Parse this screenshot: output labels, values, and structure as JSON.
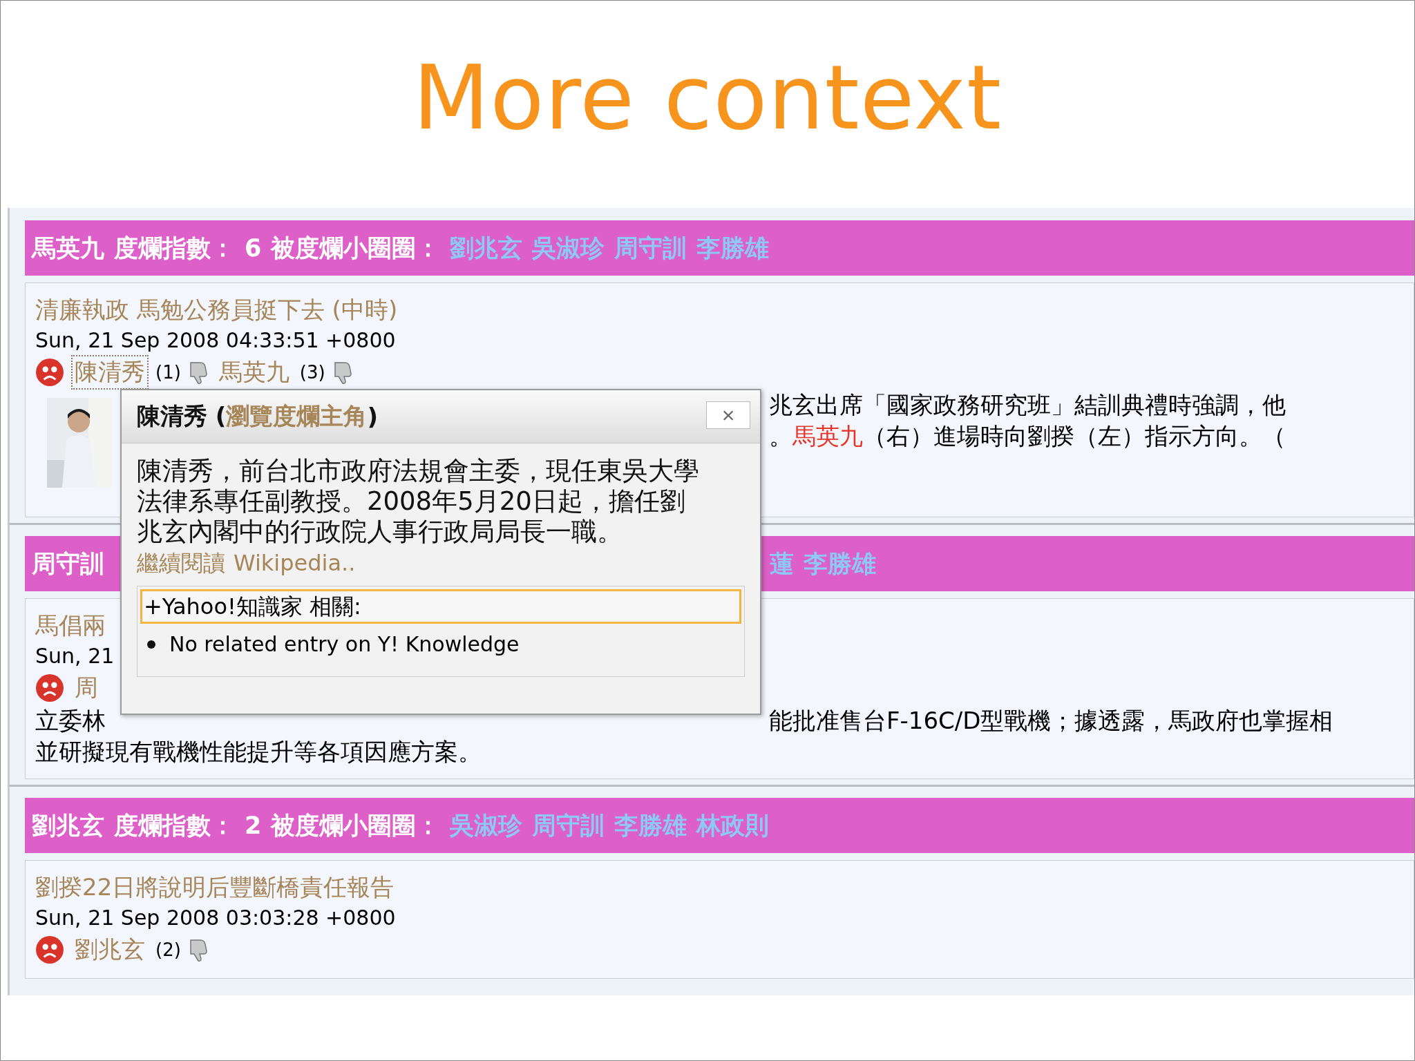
{
  "slide": {
    "title": "More context"
  },
  "sections": [
    {
      "header": {
        "name": "馬英九",
        "index_label": "度爛指數：",
        "index": "6",
        "circle_label": "被度爛小圈圈：",
        "circle": [
          "劉兆玄",
          "吳淑珍",
          "周守訓",
          "李勝雄"
        ]
      },
      "article": {
        "title": "清廉執政 馬勉公務員挺下去 (中時)",
        "date": "Sun, 21 Sep 2008 04:33:51 +0800",
        "people": [
          {
            "name": "陳清秀",
            "count": "(1)",
            "highlighted": true
          },
          {
            "name": "馬英九",
            "count": "(3)",
            "highlighted": false
          }
        ],
        "lines": [
          {
            "kind": "split",
            "right": [
              {
                "kind": "plain",
                "text": "兆玄出席「國家政務研究班」結訓典禮時強調，他"
              }
            ]
          },
          {
            "kind": "split",
            "right": [
              {
                "kind": "plain",
                "text": "。"
              },
              {
                "kind": "name",
                "text": "馬英九"
              },
              {
                "kind": "plain",
                "text": "（右）進場時向劉揆（左）指示方向。（"
              }
            ]
          }
        ]
      }
    },
    {
      "header": {
        "name": "周守訓",
        "kind": "split",
        "circle": [
          "蓮",
          "李勝雄"
        ]
      },
      "article": {
        "title": "馬倡兩",
        "date": "Sun, 21",
        "people": [
          {
            "name": "周",
            "highlighted": false
          }
        ],
        "lines": [
          {
            "kind": "split",
            "left": "立委林",
            "right": [
              {
                "kind": "plain",
                "text": "能批准售台F-16C/D型戰機；據透露，馬政府也掌握相"
              }
            ]
          },
          {
            "kind": "full",
            "right": [
              {
                "kind": "plain",
                "text": "並研擬現有戰機性能提升等各項因應方案。"
              }
            ]
          }
        ]
      }
    },
    {
      "header": {
        "name": "劉兆玄",
        "index_label": "度爛指數：",
        "index": "2",
        "circle_label": "被度爛小圈圈：",
        "circle": [
          "吳淑珍",
          "周守訓",
          "李勝雄",
          "林政則"
        ]
      },
      "article": {
        "title": "劉揆22日將說明后豐斷橋責任報告",
        "date": "Sun, 21 Sep 2008 03:03:28 +0800",
        "people": [
          {
            "name": "劉兆玄",
            "count": "(2)",
            "highlighted": false
          }
        ]
      }
    }
  ],
  "popup": {
    "name": "陳清秀 (",
    "role": "瀏覽度爛主角",
    "role_close": ")",
    "close": "×",
    "bio": "陳清秀，前台北市政府法規會主委，現任東吳大學法律系專任副教授。2008年5月20日起，擔任劉兆玄內閣中的行政院人事行政局局長一職。",
    "more_label": "繼續閱讀",
    "more_source": "Wikipedia..",
    "related_title": "+Yahoo!知識家 相關:",
    "related_items": [
      "No related entry on Y! Knowledge"
    ]
  }
}
